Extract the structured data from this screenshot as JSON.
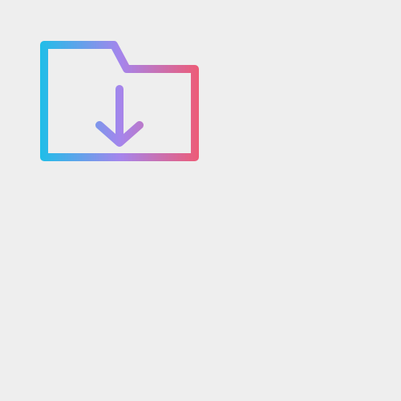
{
  "background_color": "#eeeeee",
  "icon": {
    "name": "folder-download-icon",
    "gradient": {
      "start_color": "#1dbfe8",
      "mid_color": "#a585ec",
      "end_color": "#f05a72"
    }
  }
}
